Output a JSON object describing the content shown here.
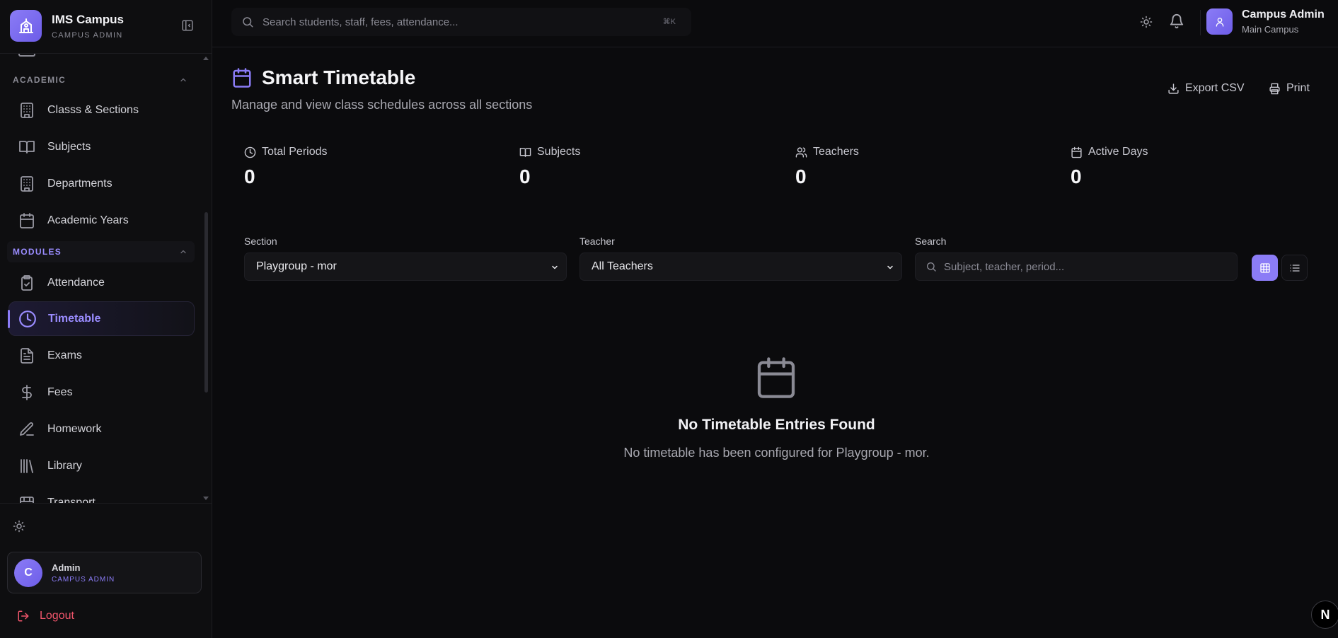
{
  "brand": {
    "title": "IMS Campus",
    "subtitle": "CAMPUS ADMIN"
  },
  "sidebar": {
    "groups": [
      {
        "label": "ACADEMIC"
      },
      {
        "label": "MODULES"
      }
    ],
    "academic_items": [
      {
        "label": "Classs & Sections",
        "icon": "building-icon"
      },
      {
        "label": "Subjects",
        "icon": "book-icon"
      },
      {
        "label": "Departments",
        "icon": "building-icon"
      },
      {
        "label": "Academic Years",
        "icon": "calendar-icon"
      }
    ],
    "module_items": [
      {
        "label": "Attendance",
        "icon": "clipboard-check-icon"
      },
      {
        "label": "Timetable",
        "icon": "clock-icon",
        "active": true
      },
      {
        "label": "Exams",
        "icon": "file-text-icon"
      },
      {
        "label": "Fees",
        "icon": "dollar-icon"
      },
      {
        "label": "Homework",
        "icon": "pen-icon"
      },
      {
        "label": "Library",
        "icon": "library-icon"
      },
      {
        "label": "Transport",
        "icon": "bus-icon"
      }
    ],
    "user": {
      "initial": "C",
      "name": "Admin",
      "role": "CAMPUS ADMIN"
    },
    "logout_label": "Logout"
  },
  "topbar": {
    "search_placeholder": "Search students, staff, fees, attendance...",
    "shortcut": "⌘K",
    "user_name": "Campus Admin",
    "user_campus": "Main Campus"
  },
  "page": {
    "title": "Smart Timetable",
    "subtitle": "Manage and view class schedules across all sections",
    "export_label": "Export CSV",
    "print_label": "Print"
  },
  "stats": [
    {
      "label": "Total Periods",
      "value": "0",
      "icon": "clock-icon"
    },
    {
      "label": "Subjects",
      "value": "0",
      "icon": "book-icon"
    },
    {
      "label": "Teachers",
      "value": "0",
      "icon": "users-icon"
    },
    {
      "label": "Active Days",
      "value": "0",
      "icon": "calendar-icon"
    }
  ],
  "filters": {
    "section_label": "Section",
    "section_value": "Playgroup - mor",
    "teacher_label": "Teacher",
    "teacher_value": "All Teachers",
    "search_label": "Search",
    "search_placeholder": "Subject, teacher, period..."
  },
  "empty": {
    "title": "No Timetable Entries Found",
    "message": "No timetable has been configured for Playgroup - mor."
  },
  "corner_badge": "N",
  "colors": {
    "accent": "#8b7cf6",
    "background": "#0b0b0d",
    "danger": "#f0556b"
  }
}
